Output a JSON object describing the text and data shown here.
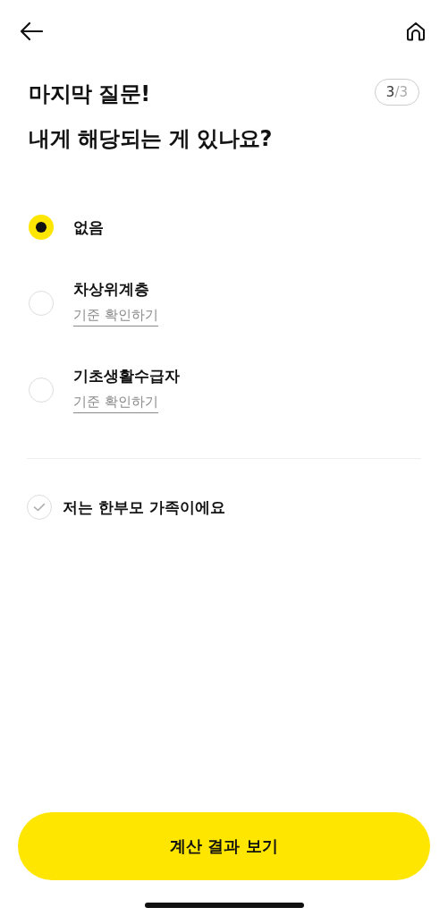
{
  "title_lines": [
    "마지막 질문!",
    "내게 해당되는 게 있나요?"
  ],
  "step": {
    "current": "3",
    "separator": "/",
    "total": "3"
  },
  "options": [
    {
      "label": "없음",
      "selected": true
    },
    {
      "label": "차상위계층",
      "link": "기준 확인하기",
      "selected": false
    },
    {
      "label": "기초생활수급자",
      "link": "기준 확인하기",
      "selected": false
    }
  ],
  "single_parent": {
    "label": "저는 한부모 가족이에요",
    "checked": false
  },
  "submit_button": "계산 결과 보기"
}
